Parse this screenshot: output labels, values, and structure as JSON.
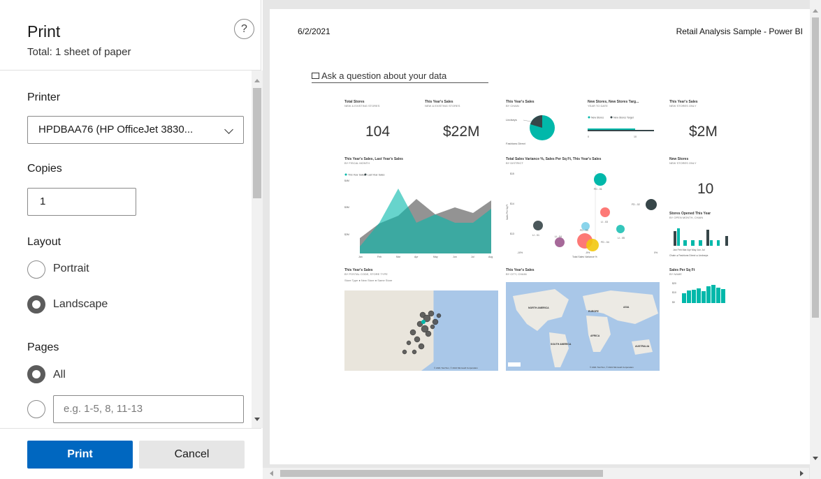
{
  "dialog": {
    "title": "Print",
    "total": "Total: 1 sheet of paper",
    "help_glyph": "?"
  },
  "printer": {
    "label": "Printer",
    "selected": "HPDBAA76 (HP OfficeJet 3830..."
  },
  "copies": {
    "label": "Copies",
    "value": "1"
  },
  "layout": {
    "label": "Layout",
    "options": [
      {
        "label": "Portrait",
        "selected": false
      },
      {
        "label": "Landscape",
        "selected": true
      }
    ]
  },
  "pages": {
    "label": "Pages",
    "all_label": "All",
    "range_placeholder": "e.g. 1-5, 8, 11-13"
  },
  "buttons": {
    "print": "Print",
    "cancel": "Cancel"
  },
  "preview": {
    "date": "6/2/2021",
    "report_title": "Retail Analysis Sample - Power BI",
    "ask": "Ask a question about your data",
    "tiles": {
      "total_stores": {
        "title": "Total Stores",
        "sub": "NEW & EXISTING STORES",
        "value": "104"
      },
      "this_year_sales": {
        "title": "This Year's Sales",
        "sub": "NEW & EXISTING STORES",
        "value": "$22M"
      },
      "sales_by_chain": {
        "title": "This Year's Sales",
        "sub": "BY CHAIN",
        "label1": "Lindseys",
        "label2": "Fashions Direct"
      },
      "new_stores_target": {
        "title": "New Stores, New Stores Targ...",
        "sub": "YEAR TO DATE",
        "legend1": "New Stores",
        "legend2": "New Stores Target",
        "tick0": "0",
        "tick1": "10"
      },
      "new_stores_sales": {
        "title": "This Year's Sales",
        "sub": "NEW STORES ONLY",
        "value": "$2M"
      },
      "monthly_sales": {
        "title": "This Year's Sales, Last Year's Sales",
        "sub": "BY FISCAL MONTH",
        "legend1": "This Year Sales",
        "legend2": "Last Year Sales",
        "y1": "$4M",
        "y2": "$3M",
        "y3": "$2M",
        "months": [
          "Jan",
          "Feb",
          "Mar",
          "Apr",
          "May",
          "Jun",
          "Jul",
          "Aug"
        ]
      },
      "variance": {
        "title": "Total Sales Variance %, Sales Per Sq Ft, This Year's Sales",
        "sub": "BY DISTRICT",
        "y1": "$15",
        "y2": "$14",
        "y3": "$13",
        "xlabel": "Total Sales Variance %",
        "ylabel": "Sales Per Sq Ft",
        "x0": "-10%",
        "x1": "-5%",
        "x2": "0%",
        "points": [
          "FD - 01",
          "FD - 02",
          "LI - 03",
          "LI - 01",
          "LI - 04",
          "FD - 03",
          "LI - 05",
          "FD - 04"
        ]
      },
      "new_stores_count": {
        "title": "New Stores",
        "sub": "NEW STORES ONLY",
        "value": "10"
      },
      "opened": {
        "title": "Stores Opened This Year",
        "sub": "BY OPEN MONTH, CHAIN",
        "months": "Jan Feb Mar Apr May Jun Jul",
        "legend": "Chain ● Fashions Direct ● Lindseys"
      },
      "postal": {
        "title": "This Year's Sales",
        "sub": "BY POSTAL CODE, STORE TYPE",
        "legend": "Store Type ● New Store ● Same Store",
        "credit": "© 2021 TomTom, © 2021 Microsoft Corporation"
      },
      "city": {
        "title": "This Year's Sales",
        "sub": "BY CITY, CHAIN",
        "na": "NORTH AMERICA",
        "eu": "EUROPE",
        "as": "ASIA",
        "af": "AFRICA",
        "sa": "SOUTH AMERICA",
        "au": "AUSTRALIA",
        "credit": "© 2021 TomTom, © 2021 Microsoft Corporation"
      },
      "sqft": {
        "title": "Sales Per Sq Ft",
        "sub": "BY NAME",
        "y1": "$20",
        "y2": "$10",
        "y3": "$0"
      }
    }
  },
  "colors": {
    "accent": "#0067c0",
    "teal": "#01b8aa",
    "dark": "#374649"
  }
}
